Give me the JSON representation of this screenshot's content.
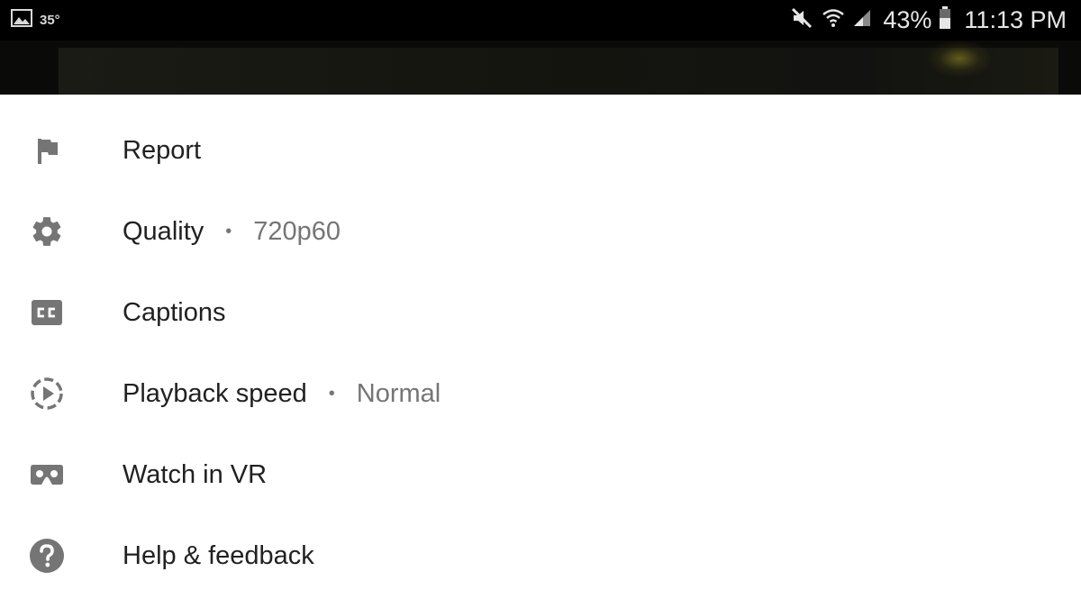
{
  "status_bar": {
    "temperature": "35°",
    "battery_percent": "43%",
    "time": "11:13 PM",
    "icons": [
      "gallery-icon",
      "mute-icon",
      "wifi-icon",
      "signal-icon",
      "battery-icon"
    ]
  },
  "menu": {
    "items": [
      {
        "label": "Report",
        "icon": "flag-icon"
      },
      {
        "label": "Quality",
        "value": "720p60",
        "separator": "•",
        "icon": "gear-icon"
      },
      {
        "label": "Captions",
        "icon": "captions-icon"
      },
      {
        "label": "Playback speed",
        "value": "Normal",
        "separator": "•",
        "icon": "playback-speed-icon"
      },
      {
        "label": "Watch in VR",
        "icon": "vr-headset-icon"
      },
      {
        "label": "Help & feedback",
        "icon": "help-icon"
      }
    ]
  },
  "colors": {
    "icon_gray": "#757575",
    "text_primary": "#212121",
    "text_secondary": "#757575",
    "status_bar_bg": "#000000"
  }
}
